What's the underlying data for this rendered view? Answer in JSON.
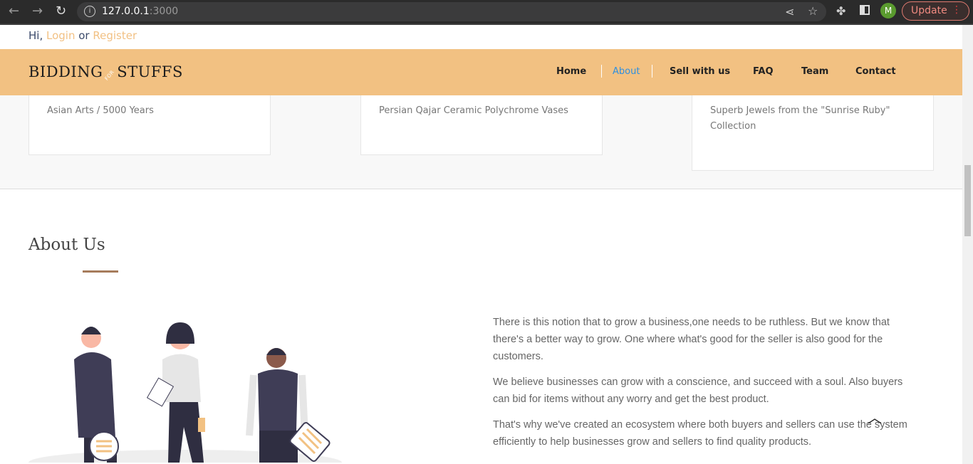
{
  "browser": {
    "url_host": "127.0.0.1",
    "url_port": ":3000",
    "profile_initial": "M",
    "update_label": "Update"
  },
  "topbar": {
    "greeting": "Hi,",
    "login": "Login",
    "or": "or",
    "register": "Register"
  },
  "header": {
    "logo_left": "BIDDING",
    "logo_mid": "FOR",
    "logo_right": "STUFFS",
    "nav": [
      "Home",
      "About",
      "Sell with us",
      "FAQ",
      "Team",
      "Contact"
    ],
    "active": "About",
    "accent": "#f2c182"
  },
  "cards": [
    "Asian Arts / 5000 Years",
    "Persian Qajar Ceramic Polychrome Vases",
    "Superb Jewels from the \"Sunrise Ruby\" Collection"
  ],
  "about": {
    "title": "About Us",
    "paragraphs": [
      "There is this notion that to grow a business,one needs to be ruthless. But we know that there's a better way to grow. One where what's good for the seller is also good for the customers.",
      "We believe businesses can grow with a conscience, and succeed with a soul. Also buyers can bid for items without any worry and get the best product.",
      "That's why we've created an ecosystem where both buyers and sellers can use the system efficiently to help businesses grow and sellers to find quality products."
    ]
  }
}
